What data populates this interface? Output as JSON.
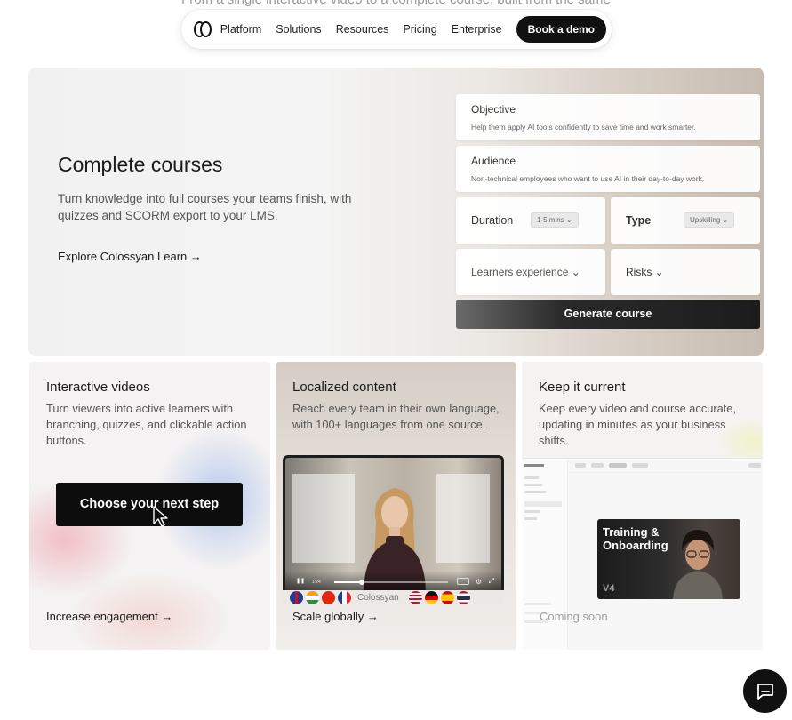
{
  "top_fade_text": "From a single interactive video to a complete course, built from the same",
  "nav": {
    "items": [
      "Platform",
      "Solutions",
      "Resources",
      "Pricing",
      "Enterprise"
    ],
    "cta": "Book a demo"
  },
  "hero": {
    "title": "Complete courses",
    "subtitle": "Turn knowledge into full courses your teams finish, with quizzes and SCORM export to your LMS.",
    "link": "Explore Colossyan Learn →",
    "form": {
      "objective_label": "Objective",
      "objective_value": "Help them apply AI tools confidently to save time and work smarter.",
      "audience_label": "Audience",
      "audience_value": "Non-technical employees who want to use AI in their day-to-day work.",
      "duration_label": "Duration",
      "duration_value": "1-5 mins ⌄",
      "type_label": "Type",
      "type_value": "Upskilling ⌄",
      "learners_label": "Learners experience ⌄",
      "risks_label": "Risks ⌄",
      "generate": "Generate course"
    }
  },
  "features": [
    {
      "title": "Interactive videos",
      "subtitle": "Turn viewers into active learners with branching, quizzes, and clickable action buttons.",
      "button": "Choose your next step",
      "link": "Increase engagement →"
    },
    {
      "title": "Localized content",
      "subtitle": "Reach every team in their own language, with 100+ languages from one source.",
      "brand": "Colossyan",
      "link": "Scale globally →"
    },
    {
      "title": "Keep it current",
      "subtitle": "Keep every video and course accurate, updating in minutes as your business shifts.",
      "thumb_title": "Training & Onboarding",
      "thumb_version": "V4",
      "link": "Coming soon"
    }
  ],
  "colors": {
    "accent": "#111111",
    "hero_gradient_end": "#c7bcb1"
  }
}
